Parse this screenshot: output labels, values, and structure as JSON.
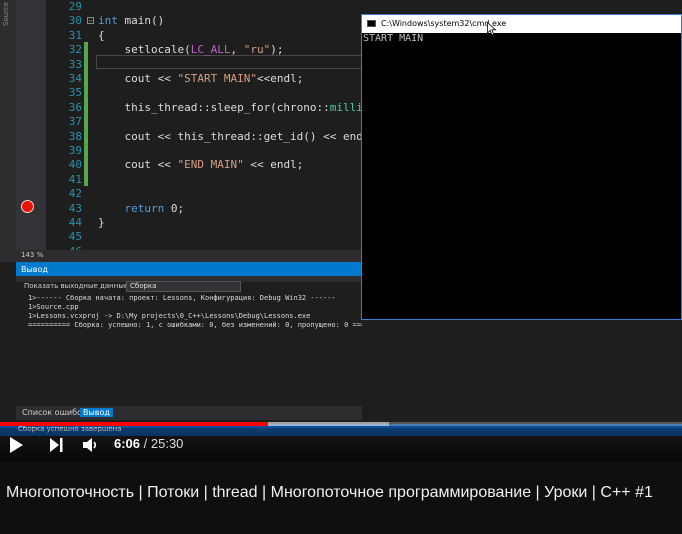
{
  "editor": {
    "side_label": "Source",
    "zoom": "143 %",
    "lines": [
      {
        "num": "29",
        "segs": [
          {
            "t": "",
            "c": "txt"
          }
        ]
      },
      {
        "num": "30",
        "segs": [
          {
            "t": "int",
            "c": "kw"
          },
          {
            "t": " main()",
            "c": "txt"
          }
        ]
      },
      {
        "num": "31",
        "segs": [
          {
            "t": "{",
            "c": "txt"
          }
        ]
      },
      {
        "num": "32",
        "segs": [
          {
            "t": "    setlocale(",
            "c": "txt"
          },
          {
            "t": "LC_ALL",
            "c": "mac"
          },
          {
            "t": ", ",
            "c": "txt"
          },
          {
            "t": "\"ru\"",
            "c": "str"
          },
          {
            "t": ");",
            "c": "txt"
          }
        ]
      },
      {
        "num": "33",
        "segs": [
          {
            "t": "",
            "c": "txt"
          }
        ]
      },
      {
        "num": "34",
        "segs": [
          {
            "t": "    cout << ",
            "c": "txt"
          },
          {
            "t": "\"START MAIN\"",
            "c": "str"
          },
          {
            "t": "<<endl;",
            "c": "txt"
          }
        ]
      },
      {
        "num": "35",
        "segs": [
          {
            "t": "",
            "c": "txt"
          }
        ]
      },
      {
        "num": "36",
        "segs": [
          {
            "t": "    this_thread::sleep_for(chrono::",
            "c": "txt"
          },
          {
            "t": "millisec",
            "c": "ty"
          }
        ]
      },
      {
        "num": "37",
        "segs": [
          {
            "t": "",
            "c": "txt"
          }
        ]
      },
      {
        "num": "38",
        "segs": [
          {
            "t": "    cout << this_thread::get_id() << endl;",
            "c": "txt"
          }
        ]
      },
      {
        "num": "39",
        "segs": [
          {
            "t": "",
            "c": "txt"
          }
        ]
      },
      {
        "num": "40",
        "segs": [
          {
            "t": "    cout << ",
            "c": "txt"
          },
          {
            "t": "\"END MAIN\"",
            "c": "str"
          },
          {
            "t": " << endl;",
            "c": "txt"
          }
        ]
      },
      {
        "num": "41",
        "segs": [
          {
            "t": "",
            "c": "txt"
          }
        ]
      },
      {
        "num": "42",
        "segs": [
          {
            "t": "",
            "c": "txt"
          }
        ]
      },
      {
        "num": "43",
        "segs": [
          {
            "t": "    ",
            "c": "txt"
          },
          {
            "t": "return",
            "c": "kw"
          },
          {
            "t": " 0;",
            "c": "txt"
          }
        ]
      },
      {
        "num": "44",
        "segs": [
          {
            "t": "}",
            "c": "txt"
          }
        ]
      },
      {
        "num": "45",
        "segs": [
          {
            "t": "",
            "c": "txt"
          }
        ]
      },
      {
        "num": "46",
        "segs": [
          {
            "t": "",
            "c": "txt"
          }
        ]
      }
    ]
  },
  "console": {
    "title": "C:\\Windows\\system32\\cmd.exe",
    "output": "START MAIN"
  },
  "output_pane": {
    "header": "Вывод",
    "show_label": "Показать выходные данные из:",
    "source": "Сборка",
    "lines": [
      "1>------ Сборка начата: проект: Lessons, Конфигурация: Debug Win32 ------",
      "1>Source.cpp",
      "1>Lessons.vcxproj -> D:\\My projects\\0_C++\\Lessons\\Debug\\Lessons.exe",
      "========== Сборка: успешно: 1, с ошибками: 0, без изменений: 0, пропущено: 0 =========="
    ],
    "tabs": [
      "Список ошибок",
      "Вывод"
    ]
  },
  "status_bar": {
    "text": "Сборка успешно завершена"
  },
  "player": {
    "current_time": "6:06",
    "separator": " / ",
    "duration": "25:30",
    "progress_fraction": 0.393,
    "buffered_fraction": 0.57,
    "icons": [
      "play-icon",
      "next-icon",
      "volume-icon"
    ]
  },
  "video_title": "Многопоточность | Потоки | thread | Многопоточное программирование | Уроки | C++ #1"
}
